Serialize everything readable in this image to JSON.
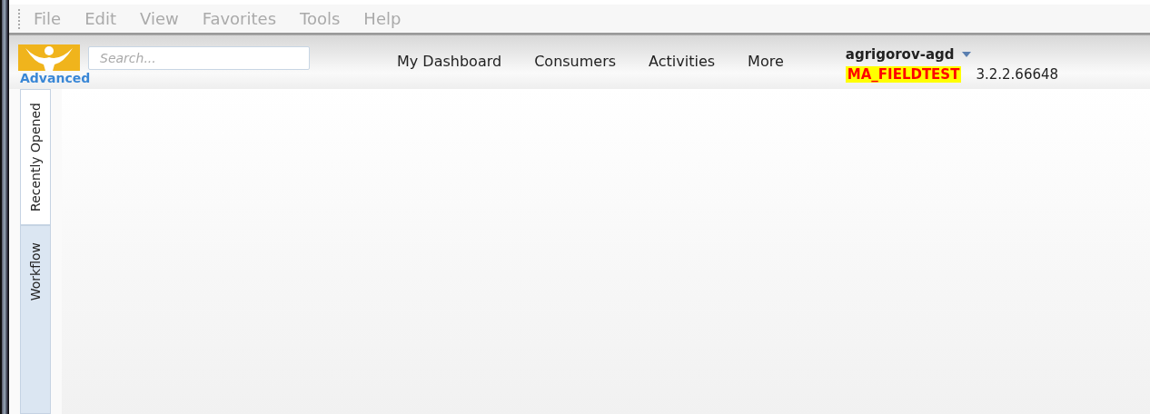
{
  "menu_bar": [
    "File",
    "Edit",
    "View",
    "Favorites",
    "Tools",
    "Help"
  ],
  "search": {
    "placeholder": "Search..."
  },
  "advanced_link": "Advanced",
  "nav": [
    "My Dashboard",
    "Consumers",
    "Activities",
    "More"
  ],
  "user": {
    "name": "agrigorov-agd",
    "environment": "MA_FIELDTEST",
    "version": "3.2.2.66648"
  },
  "side_tabs": [
    {
      "label": "Recently Opened",
      "selected": true
    },
    {
      "label": "Workflow",
      "selected": false
    }
  ]
}
